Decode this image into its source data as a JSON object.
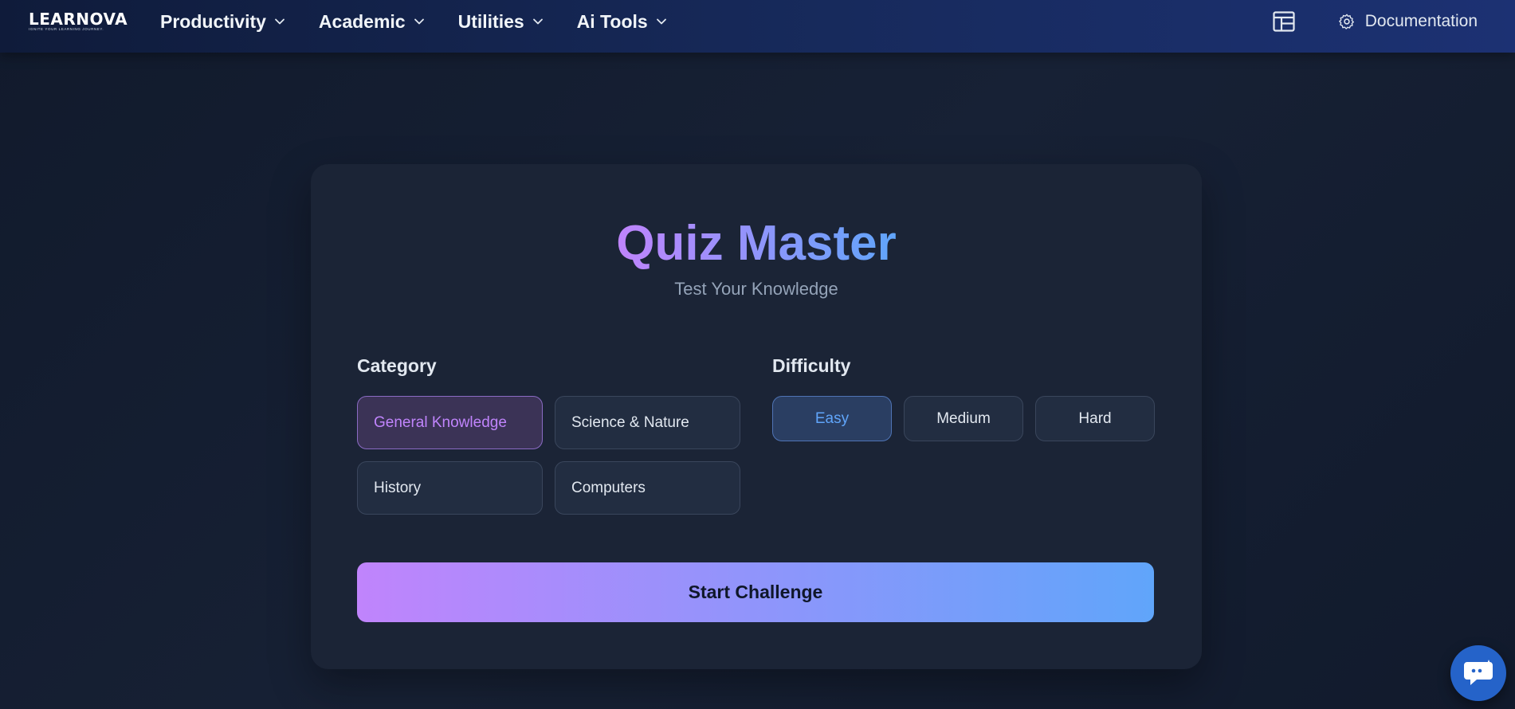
{
  "brand": {
    "logo_text": "LEARNOVA",
    "tagline": "IGNITE YOUR LEARNING JOURNEY."
  },
  "nav": {
    "items": [
      {
        "label": "Productivity"
      },
      {
        "label": "Academic"
      },
      {
        "label": "Utilities"
      },
      {
        "label": "Ai Tools"
      }
    ],
    "documentation_label": "Documentation"
  },
  "quiz": {
    "title": "Quiz Master",
    "subtitle": "Test Your Knowledge",
    "category_label": "Category",
    "categories": [
      {
        "label": "General Knowledge",
        "selected": true
      },
      {
        "label": "Science & Nature",
        "selected": false
      },
      {
        "label": "History",
        "selected": false
      },
      {
        "label": "Computers",
        "selected": false
      }
    ],
    "difficulty_label": "Difficulty",
    "difficulties": [
      {
        "label": "Easy",
        "selected": true
      },
      {
        "label": "Medium",
        "selected": false
      },
      {
        "label": "Hard",
        "selected": false
      }
    ],
    "start_label": "Start Challenge"
  },
  "colors": {
    "accent_purple": "#c084fc",
    "accent_blue": "#60a5fa",
    "chat_button": "#2563c9"
  },
  "icons": {
    "nav_dropdown": "chevron-down-icon",
    "layout": "layout-icon",
    "documentation": "gear-icon",
    "chat": "chat-icon"
  }
}
